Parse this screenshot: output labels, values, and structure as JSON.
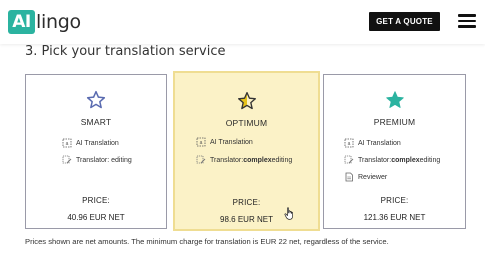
{
  "header": {
    "logo_mark": "AI",
    "logo_text": "lingo",
    "quote_button": "GET A QUOTE",
    "menu_icon": "hamburger-menu-icon"
  },
  "section": {
    "title": "3. Pick your translation service"
  },
  "plans": [
    {
      "name": "SMART",
      "icon": "star-outline-icon",
      "icon_color": "#5a6bb0",
      "features": [
        {
          "icon": "ai-translation-icon",
          "text": "AI Translation",
          "bold": "",
          "after": ""
        },
        {
          "icon": "editing-icon",
          "text": "Translator: editing",
          "bold": "",
          "after": ""
        }
      ],
      "price_label": "PRICE:",
      "price": "40.96 EUR NET"
    },
    {
      "name": "OPTIMUM",
      "icon": "star-half-icon",
      "icon_color": "#e6c21a",
      "highlight_color": "#fbf2c7",
      "features": [
        {
          "icon": "ai-translation-icon",
          "text": "AI Translation",
          "bold": "",
          "after": ""
        },
        {
          "icon": "editing-icon",
          "text": "Translator: ",
          "bold": "complex",
          "after": " editing"
        }
      ],
      "price_label": "PRICE:",
      "price": "98.6 EUR NET"
    },
    {
      "name": "PREMIUM",
      "icon": "star-filled-icon",
      "icon_color": "#2bb3a0",
      "features": [
        {
          "icon": "ai-translation-icon",
          "text": "AI Translation",
          "bold": "",
          "after": ""
        },
        {
          "icon": "editing-icon",
          "text": "Translator: ",
          "bold": "complex",
          "after": " editing"
        },
        {
          "icon": "reviewer-icon",
          "text": "Reviewer",
          "bold": "",
          "after": ""
        }
      ],
      "price_label": "PRICE:",
      "price": "121.36 EUR NET"
    }
  ],
  "footnote": "Prices shown are net amounts. The minimum charge for translation is EUR 22 net, regardless of the service."
}
